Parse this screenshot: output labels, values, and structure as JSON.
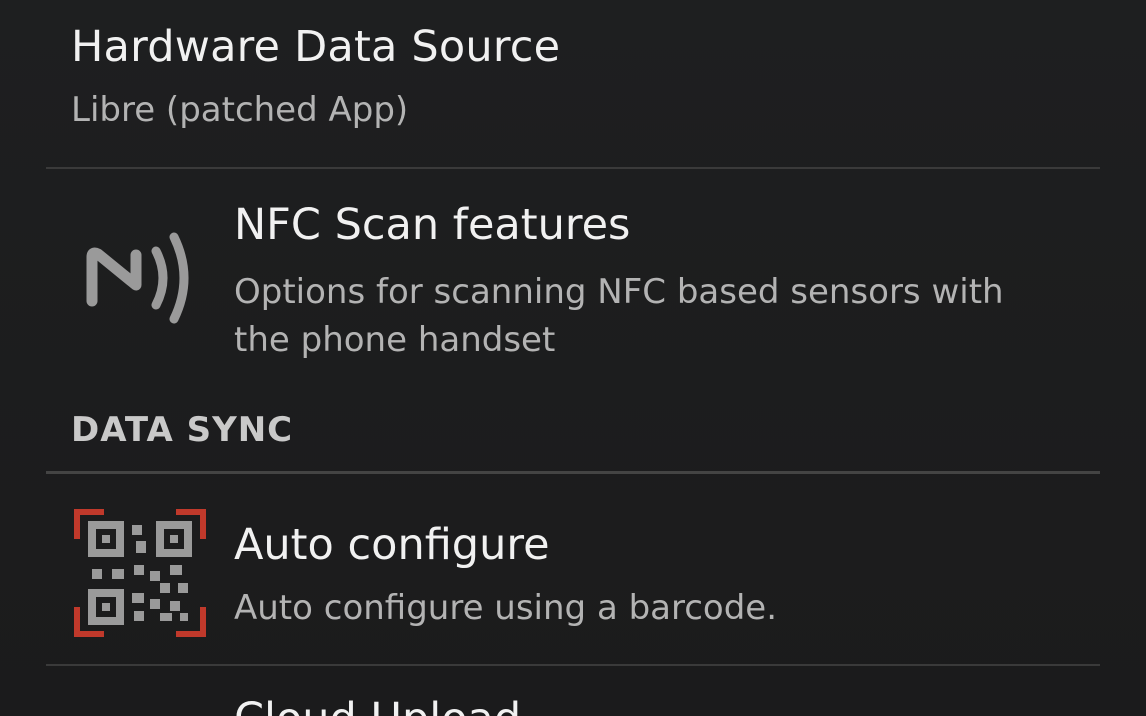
{
  "preferences": {
    "hardware_source": {
      "title": "Hardware Data Source",
      "summary": "Libre (patched App)"
    },
    "nfc_scan": {
      "title": "NFC Scan features",
      "summary": "Options for scanning NFC based sensors with the phone handset",
      "icon": "nfc-icon"
    },
    "data_sync_category": "DATA SYNC",
    "auto_configure": {
      "title": "Auto configure",
      "summary": "Auto configure using a barcode.",
      "icon": "qr-code-icon"
    },
    "cloud_upload": {
      "title": "Cloud Upload"
    }
  },
  "colors": {
    "background": "#1e1f20",
    "title_text": "#f1f1f1",
    "summary_text": "#b3b3b3",
    "category_text": "#c9c9c9",
    "divider": "#3a3a3a",
    "icon_gray": "#9a9a9a",
    "qr_accent": "#c0392b"
  }
}
